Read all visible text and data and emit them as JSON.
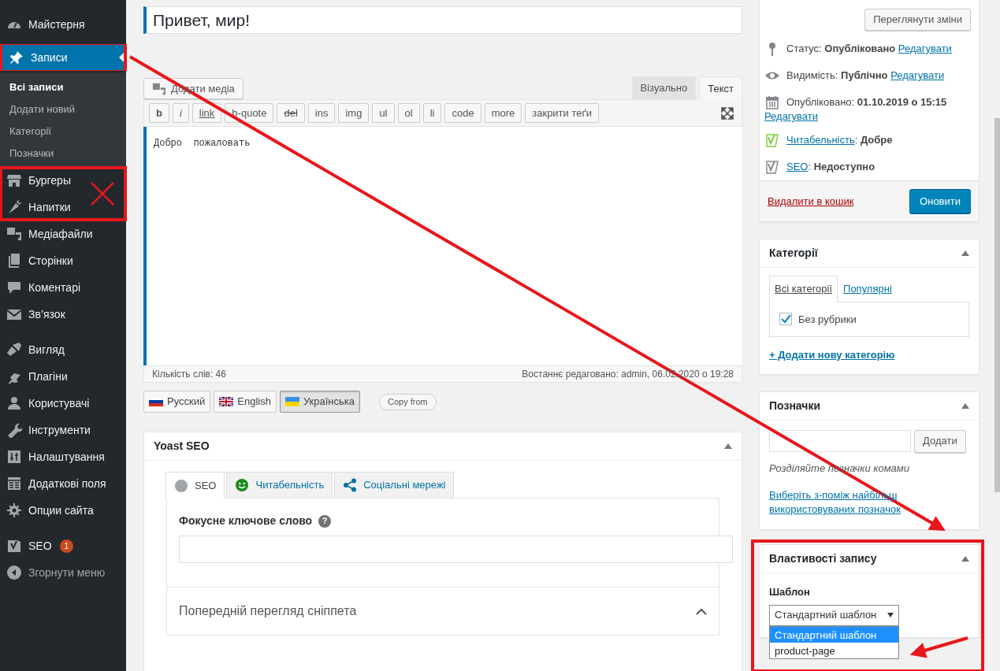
{
  "sidebar": {
    "sections": [
      {
        "items": [
          {
            "label": "Майстерня",
            "selected": false,
            "annotated": false,
            "crossed": false
          },
          {
            "label": "Записи",
            "selected": true,
            "annotated": true,
            "crossed": false,
            "submenu": [
              {
                "label": "Всі записи",
                "selected": true
              },
              {
                "label": "Додати новий",
                "selected": false
              },
              {
                "label": "Категорії",
                "selected": false
              },
              {
                "label": "Позначки",
                "selected": false
              }
            ]
          },
          {
            "label": "Бургеры",
            "selected": false,
            "annotated": true,
            "crossed": true
          },
          {
            "label": "Напитки",
            "selected": false,
            "annotated": true,
            "crossed": true
          },
          {
            "label": "Медіафайли",
            "selected": false,
            "annotated": false,
            "crossed": false
          },
          {
            "label": "Сторінки",
            "selected": false,
            "annotated": false,
            "crossed": false
          },
          {
            "label": "Коментарі",
            "selected": false,
            "annotated": false,
            "crossed": false
          },
          {
            "label": "Зв’язок",
            "selected": false,
            "annotated": false,
            "crossed": false
          }
        ]
      },
      {
        "items": [
          {
            "label": "Вигляд",
            "selected": false,
            "annotated": false,
            "crossed": false
          },
          {
            "label": "Плагіни",
            "selected": false,
            "annotated": false,
            "crossed": false
          },
          {
            "label": "Користувачі",
            "selected": false,
            "annotated": false,
            "crossed": false
          },
          {
            "label": "Інструменти",
            "selected": false,
            "annotated": false,
            "crossed": false
          },
          {
            "label": "Налаштування",
            "selected": false,
            "annotated": false,
            "crossed": false
          },
          {
            "label": "Додаткові поля",
            "selected": false,
            "annotated": false,
            "crossed": false
          },
          {
            "label": "Опции сайта",
            "selected": false,
            "annotated": false,
            "crossed": false
          }
        ]
      },
      {
        "items": [
          {
            "label": "SEO",
            "selected": false,
            "annotated": false,
            "crossed": false,
            "badge": "1"
          }
        ]
      }
    ],
    "collapse": "Згорнути меню"
  },
  "post_title": "Привет, мир!",
  "editor": {
    "add_media": "Додати медіа",
    "tabs": [
      {
        "label": "Візуально",
        "selected": false
      },
      {
        "label": "Текст",
        "selected": true
      }
    ],
    "quicktags": [
      {
        "label": "b",
        "kind": "bold"
      },
      {
        "label": "i",
        "kind": "italic"
      },
      {
        "label": "link",
        "kind": "underline"
      },
      {
        "label": "b-quote",
        "kind": "plain"
      },
      {
        "label": "del",
        "kind": "strike"
      },
      {
        "label": "ins",
        "kind": "plain"
      },
      {
        "label": "img",
        "kind": "plain"
      },
      {
        "label": "ul",
        "kind": "plain"
      },
      {
        "label": "ol",
        "kind": "plain"
      },
      {
        "label": "li",
        "kind": "plain"
      },
      {
        "label": "code",
        "kind": "plain"
      },
      {
        "label": "more",
        "kind": "plain"
      },
      {
        "label": "закрити теґи",
        "kind": "plain"
      }
    ],
    "content": "Добро  пожаловать",
    "word_count": "Кількість слів: 46",
    "last_edited": "Востаннє редаговано: admin, 06.02.2020 о 19:28"
  },
  "languages": [
    {
      "label": "Русский",
      "selected": false
    },
    {
      "label": "English",
      "selected": false
    },
    {
      "label": "Українська",
      "selected": true
    }
  ],
  "copy_from": "Copy from",
  "yoast": {
    "title": "Yoast SEO",
    "tabs": [
      {
        "label": "SEO",
        "selected": true
      },
      {
        "label": "Читабельність",
        "selected": false
      },
      {
        "label": "Соціальні мережі",
        "selected": false
      }
    ],
    "focus_keyword_label": "Фокусне ключове слово",
    "help": "?",
    "snippet_preview": "Попередній перегляд сніппета"
  },
  "publish": {
    "preview_button": "Переглянути зміни",
    "rows": [
      {
        "kind": "meta",
        "label": "Статус:",
        "value": "Опубліковано",
        "edit": "Редагувати"
      },
      {
        "kind": "meta",
        "label": "Видимість:",
        "value": "Публічно",
        "edit": "Редагувати"
      },
      {
        "kind": "meta",
        "label": "Опубліковано:",
        "value": "01.10.2019 о 15:15",
        "edit": "Редагувати"
      },
      {
        "kind": "score",
        "link": "Читабельність",
        "rest": ": **Добре**",
        "color": "#7ad03a"
      },
      {
        "kind": "score",
        "link": "SEO",
        "rest": ": **Недоступно**",
        "color": "#888888"
      }
    ],
    "trash": "Видалити в кошик",
    "update": "Оновити"
  },
  "categories": {
    "title": "Категорії",
    "tabs": [
      {
        "label": "Всі категорії",
        "selected": true
      },
      {
        "label": "Популярні",
        "selected": false
      }
    ],
    "items": [
      {
        "label": "Без рубрики",
        "checked": true
      }
    ],
    "add_new": "+ Додати нову категорію"
  },
  "tags": {
    "title": "Позначки",
    "add_button": "Додати",
    "hint": "Розділяйте позначки комами",
    "choose_link": "Виберіть з-поміж найбільш використовуваних позначок"
  },
  "post_attributes": {
    "title": "Властивості запису",
    "annotated": true,
    "template_label": "Шаблон",
    "template_value": "Стандартний шаблон",
    "open": true,
    "options": [
      {
        "label": "Стандартний шаблон",
        "selected": true
      },
      {
        "label": "product-page",
        "selected": false
      }
    ]
  }
}
